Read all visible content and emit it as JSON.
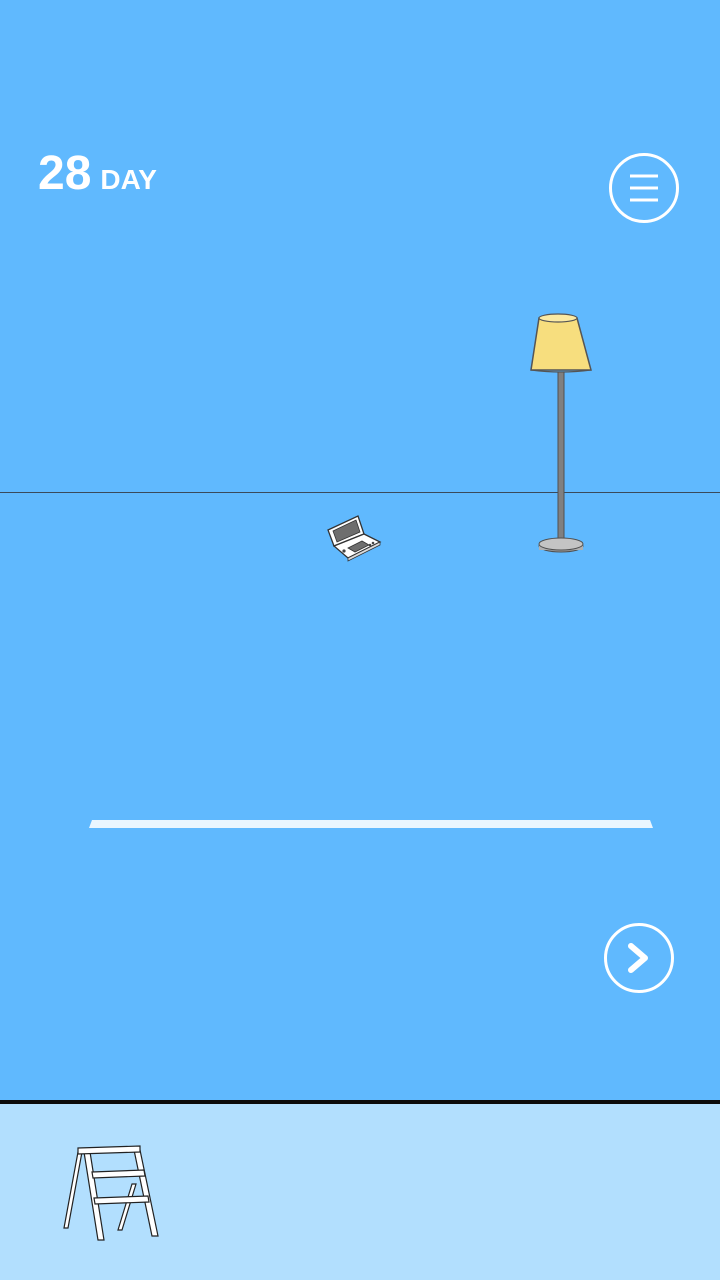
{
  "hud": {
    "day_number": "28",
    "day_label": "DAY"
  },
  "buttons": {
    "menu_icon": "hamburger-menu-icon",
    "next_icon": "chevron-right-icon"
  },
  "scene": {
    "objects": [
      "floor-lamp",
      "handheld-game-console"
    ]
  },
  "inventory": {
    "items": [
      "step-ladder"
    ]
  },
  "colors": {
    "sky": "#60b9fe",
    "inventory_bar": "#b2dffe",
    "lamp_shade": "#f7de7e",
    "ui_white": "#ffffff"
  }
}
